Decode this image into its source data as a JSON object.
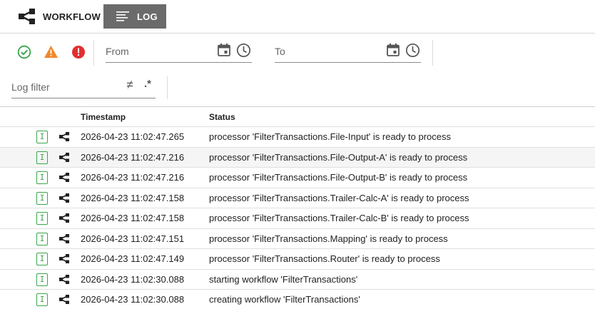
{
  "tabs": {
    "workflow_label": "WORKFLOW",
    "log_label": "LOG"
  },
  "filters": {
    "from_placeholder": "From",
    "to_placeholder": "To",
    "log_filter_placeholder": "Log filter",
    "not_equal_symbol": "≠",
    "regex_symbol": ".*"
  },
  "colors": {
    "success": "#3aa64a",
    "warning": "#f0892a",
    "error": "#e03030",
    "active_tab": "#6b6b6b"
  },
  "table": {
    "columns": {
      "timestamp": "Timestamp",
      "status": "Status"
    },
    "rows": [
      {
        "level": "I",
        "timestamp": "2026-04-23 11:02:47.265",
        "status": "processor 'FilterTransactions.File-Input' is ready to process"
      },
      {
        "level": "I",
        "timestamp": "2026-04-23 11:02:47.216",
        "status": "processor 'FilterTransactions.File-Output-A' is ready to process"
      },
      {
        "level": "I",
        "timestamp": "2026-04-23 11:02:47.216",
        "status": "processor 'FilterTransactions.File-Output-B' is ready to process"
      },
      {
        "level": "I",
        "timestamp": "2026-04-23 11:02:47.158",
        "status": "processor 'FilterTransactions.Trailer-Calc-A' is ready to process"
      },
      {
        "level": "I",
        "timestamp": "2026-04-23 11:02:47.158",
        "status": "processor 'FilterTransactions.Trailer-Calc-B' is ready to process"
      },
      {
        "level": "I",
        "timestamp": "2026-04-23 11:02:47.151",
        "status": "processor 'FilterTransactions.Mapping' is ready to process"
      },
      {
        "level": "I",
        "timestamp": "2026-04-23 11:02:47.149",
        "status": "processor 'FilterTransactions.Router' is ready to process"
      },
      {
        "level": "I",
        "timestamp": "2026-04-23 11:02:30.088",
        "status": "starting workflow 'FilterTransactions'"
      },
      {
        "level": "I",
        "timestamp": "2026-04-23 11:02:30.088",
        "status": "creating workflow 'FilterTransactions'"
      }
    ]
  }
}
